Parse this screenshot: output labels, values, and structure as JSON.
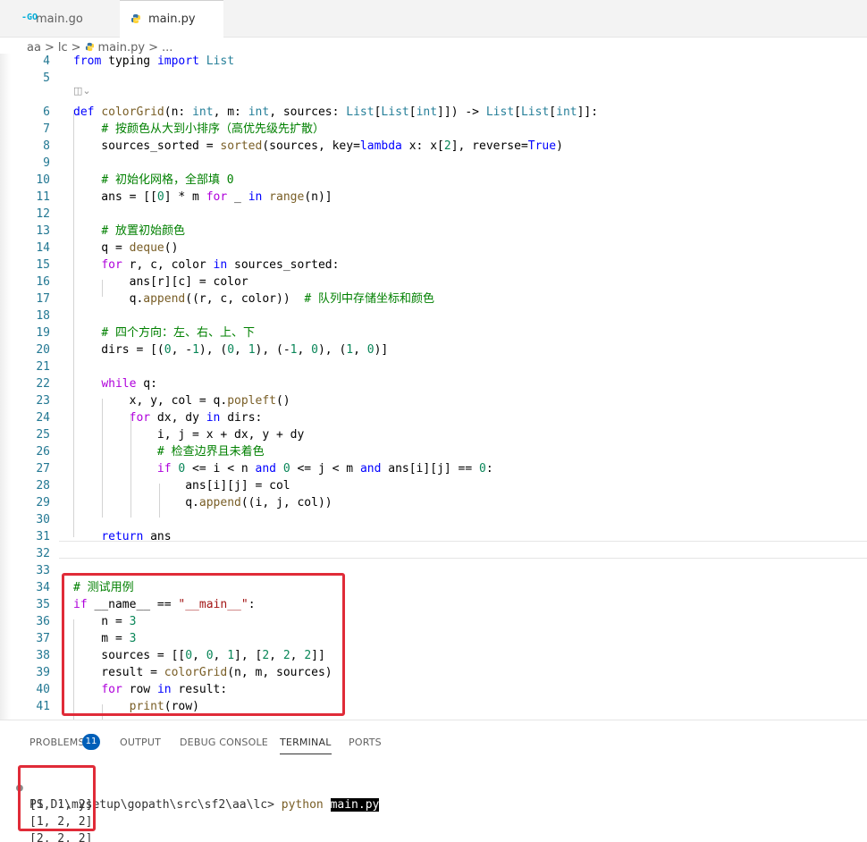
{
  "tabs": [
    {
      "icon": "go-icon",
      "icon_glyph": "-GO",
      "label": "main.go",
      "active": false
    },
    {
      "icon": "python-icon",
      "icon_glyph": "py",
      "label": "main.py",
      "active": true
    }
  ],
  "breadcrumb": [
    "aa",
    ">",
    "lc",
    ">",
    "main.py",
    ">",
    "..."
  ],
  "editor": {
    "codelens_glyph": "◫⌄",
    "lines": [
      {
        "n": "4",
        "code": "from typing import List"
      },
      {
        "n": "5",
        "code": ""
      },
      {
        "n": "6",
        "code": "def colorGrid(n: int, m: int, sources: List[List[int]]) -> List[List[int]]:"
      },
      {
        "n": "7",
        "code": "    # 按颜色从大到小排序（高优先级先扩散）"
      },
      {
        "n": "8",
        "code": "    sources_sorted = sorted(sources, key=lambda x: x[2], reverse=True)"
      },
      {
        "n": "9",
        "code": ""
      },
      {
        "n": "10",
        "code": "    # 初始化网格，全部填 0"
      },
      {
        "n": "11",
        "code": "    ans = [[0] * m for _ in range(n)]"
      },
      {
        "n": "12",
        "code": ""
      },
      {
        "n": "13",
        "code": "    # 放置初始颜色"
      },
      {
        "n": "14",
        "code": "    q = deque()"
      },
      {
        "n": "15",
        "code": "    for r, c, color in sources_sorted:"
      },
      {
        "n": "16",
        "code": "        ans[r][c] = color"
      },
      {
        "n": "17",
        "code": "        q.append((r, c, color))  # 队列中存储坐标和颜色"
      },
      {
        "n": "18",
        "code": ""
      },
      {
        "n": "19",
        "code": "    # 四个方向：左、右、上、下"
      },
      {
        "n": "20",
        "code": "    dirs = [(0, -1), (0, 1), (-1, 0), (1, 0)]"
      },
      {
        "n": "21",
        "code": ""
      },
      {
        "n": "22",
        "code": "    while q:"
      },
      {
        "n": "23",
        "code": "        x, y, col = q.popleft()"
      },
      {
        "n": "24",
        "code": "        for dx, dy in dirs:"
      },
      {
        "n": "25",
        "code": "            i, j = x + dx, y + dy"
      },
      {
        "n": "26",
        "code": "            # 检查边界且未着色"
      },
      {
        "n": "27",
        "code": "            if 0 <= i < n and 0 <= j < m and ans[i][j] == 0:"
      },
      {
        "n": "28",
        "code": "                ans[i][j] = col"
      },
      {
        "n": "29",
        "code": "                q.append((i, j, col))"
      },
      {
        "n": "30",
        "code": ""
      },
      {
        "n": "31",
        "code": "    return ans"
      },
      {
        "n": "32",
        "code": ""
      },
      {
        "n": "33",
        "code": ""
      },
      {
        "n": "34",
        "code": "# 测试用例"
      },
      {
        "n": "35",
        "code": "if __name__ == \"__main__\":"
      },
      {
        "n": "36",
        "code": "    n = 3"
      },
      {
        "n": "37",
        "code": "    m = 3"
      },
      {
        "n": "38",
        "code": "    sources = [[0, 0, 1], [2, 2, 2]]"
      },
      {
        "n": "39",
        "code": "    result = colorGrid(n, m, sources)"
      },
      {
        "n": "40",
        "code": "    for row in result:"
      },
      {
        "n": "41",
        "code": "        print(row)"
      }
    ]
  },
  "panel": {
    "tabs": [
      {
        "label": "PROBLEMS",
        "badge": "11"
      },
      {
        "label": "OUTPUT"
      },
      {
        "label": "DEBUG CONSOLE"
      },
      {
        "label": "TERMINAL",
        "active": true
      },
      {
        "label": "PORTS"
      }
    ],
    "terminal": {
      "prompt_path": "PS D:\\mysetup\\gopath\\src\\sf2\\aa\\lc>",
      "command": "python",
      "argument": "main.py",
      "output": [
        "[1, 1, 2]",
        "[1, 2, 2]",
        "[2, 2, 2]"
      ]
    }
  },
  "colors": {
    "accent": "#005fb8",
    "highlight_box": "#e02b38",
    "keyword": "#0000ff",
    "control_keyword": "#af00db",
    "function": "#795e26",
    "type": "#267f99",
    "number": "#098658",
    "string": "#a31515",
    "comment": "#008000"
  }
}
